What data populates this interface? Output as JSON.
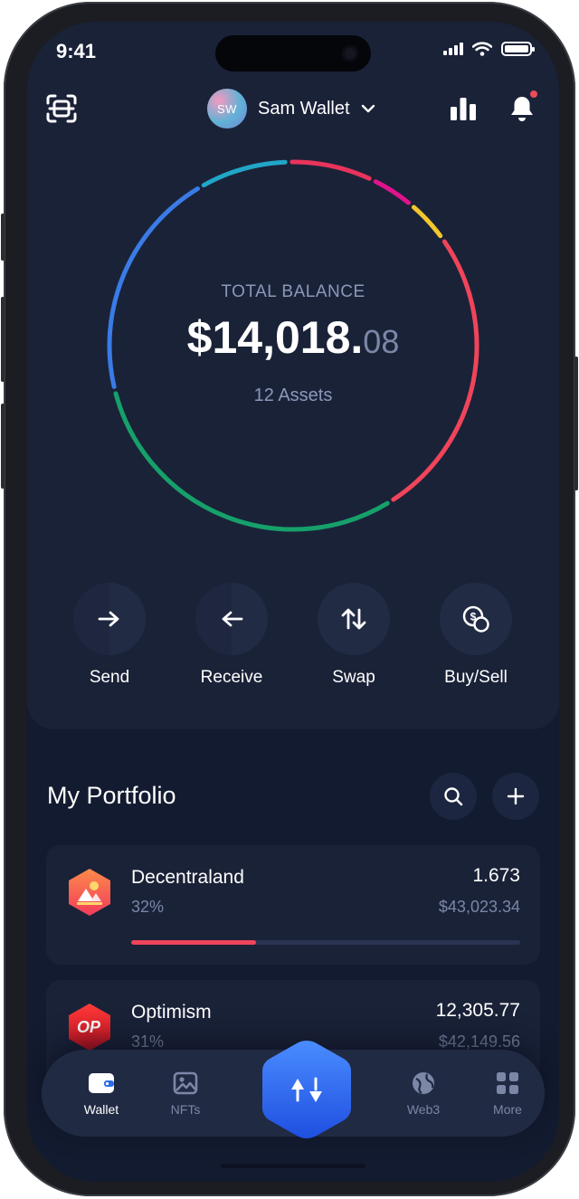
{
  "status_bar": {
    "time": "9:41"
  },
  "header": {
    "avatar_initials": "SW",
    "wallet_name": "Sam Wallet"
  },
  "balance": {
    "label": "TOTAL BALANCE",
    "whole": "$14,018.",
    "cents": "08",
    "assets_count": "12 Assets"
  },
  "ring_segments": [
    {
      "color": "#3a7be6",
      "share": 0.205
    },
    {
      "color": "#21a6c8",
      "share": 0.08
    },
    {
      "color": "#e8345c",
      "share": 0.075
    },
    {
      "color": "#e0138c",
      "share": 0.04
    },
    {
      "color": "#f2c62c",
      "share": 0.04
    },
    {
      "color": "#f0445a",
      "share": 0.26
    },
    {
      "color": "#16a06a",
      "share": 0.3
    }
  ],
  "actions": [
    {
      "label": "Send",
      "icon": "arrow-right-icon"
    },
    {
      "label": "Receive",
      "icon": "arrow-left-icon"
    },
    {
      "label": "Swap",
      "icon": "swap-arrows-icon"
    },
    {
      "label": "Buy/Sell",
      "icon": "dollar-coin-icon"
    }
  ],
  "portfolio": {
    "title": "My Portfolio",
    "assets": [
      {
        "name": "Decentraland",
        "percent": "32%",
        "amount": "1.673",
        "value": "$43,023.34",
        "share": 0.32,
        "color": "#f0445a",
        "logo_text": ""
      },
      {
        "name": "Optimism",
        "percent": "31%",
        "amount": "12,305.77",
        "value": "$42,149.56",
        "share": 0.31,
        "color": "#f0445a",
        "logo_text": "OP"
      }
    ]
  },
  "tabbar": {
    "tabs": [
      {
        "label": "Wallet",
        "icon": "wallet-icon",
        "active": true
      },
      {
        "label": "NFTs",
        "icon": "image-icon",
        "active": false
      },
      {
        "label": "Web3",
        "icon": "globe-icon",
        "active": false
      },
      {
        "label": "More",
        "icon": "grid-icon",
        "active": false
      }
    ]
  }
}
